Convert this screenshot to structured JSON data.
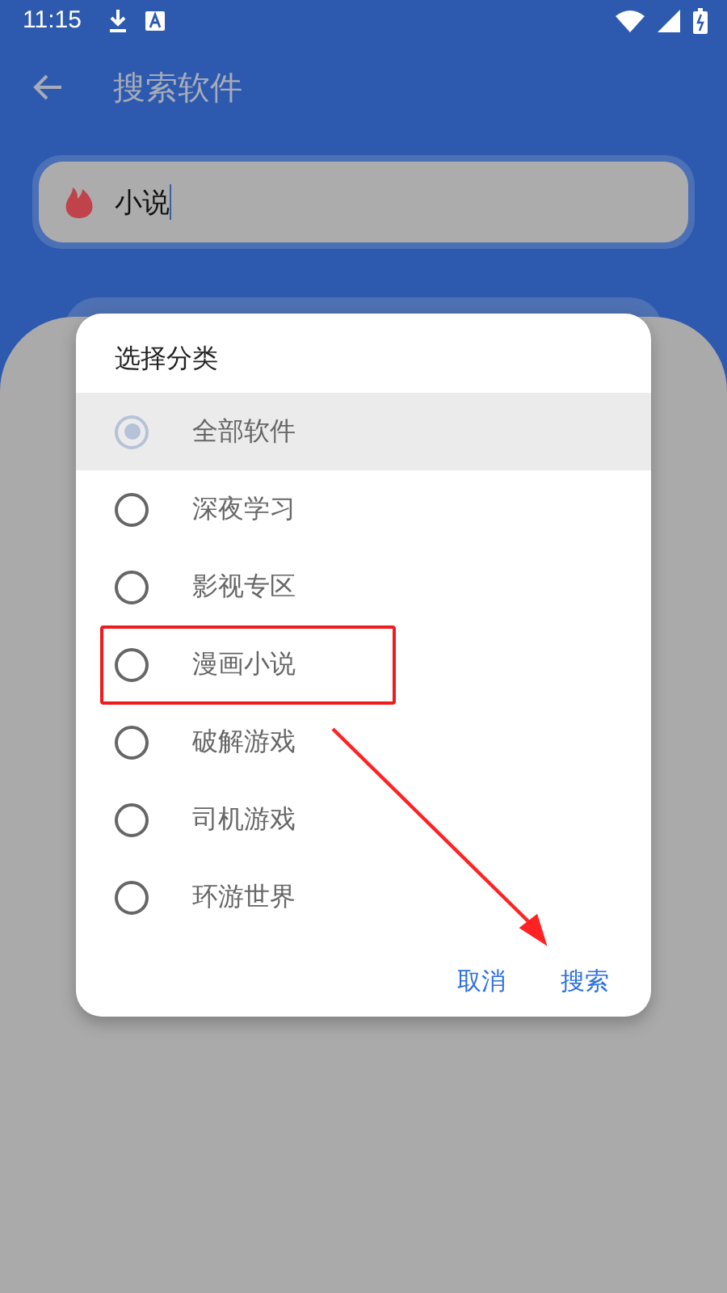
{
  "status_bar": {
    "time": "11:15"
  },
  "app_bar": {
    "title": "搜索软件"
  },
  "search": {
    "value": "小说"
  },
  "dialog": {
    "title": "选择分类",
    "options": [
      {
        "label": "全部软件",
        "selected": true
      },
      {
        "label": "深夜学习",
        "selected": false
      },
      {
        "label": "影视专区",
        "selected": false
      },
      {
        "label": "漫画小说",
        "selected": false
      },
      {
        "label": "破解游戏",
        "selected": false
      },
      {
        "label": "司机游戏",
        "selected": false
      },
      {
        "label": "环游世界",
        "selected": false
      }
    ],
    "buttons": [
      "取消",
      "搜索"
    ]
  }
}
